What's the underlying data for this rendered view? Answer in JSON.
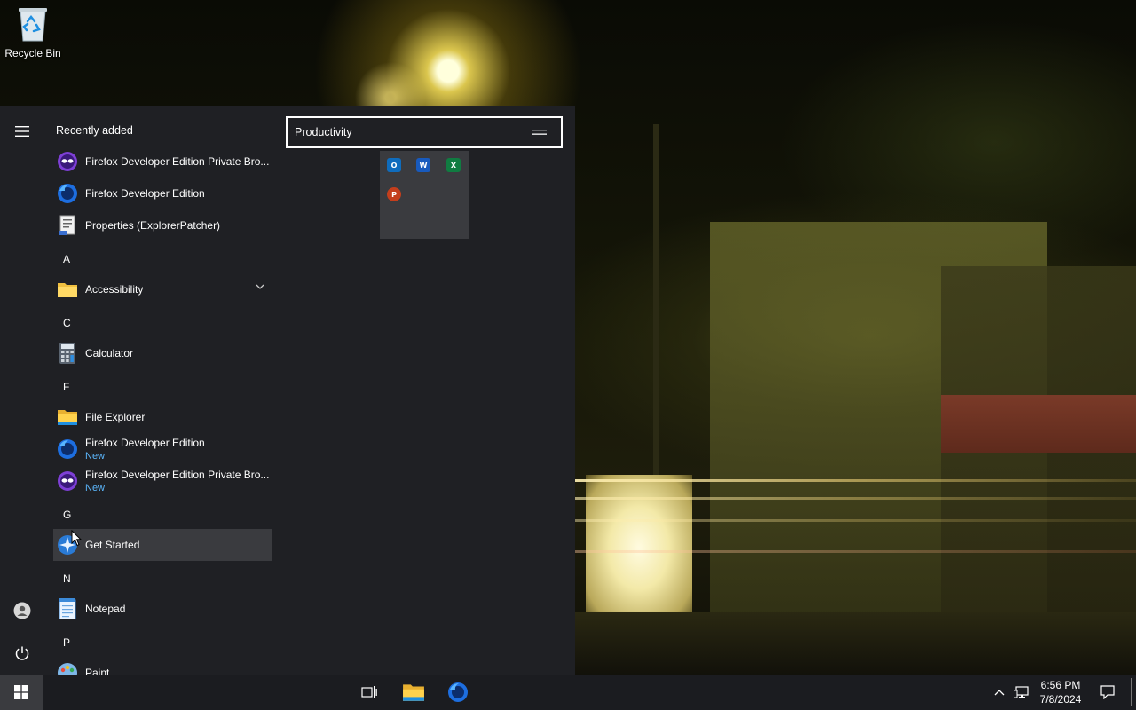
{
  "desktop": {
    "icons": [
      {
        "label": "Recycle Bin",
        "icon": "recycle-bin-icon"
      }
    ]
  },
  "start_menu": {
    "recently_added_title": "Recently added",
    "recently_added": [
      {
        "label": "Firefox Developer Edition Private Bro...",
        "icon": "firefox-private-icon"
      },
      {
        "label": "Firefox Developer Edition",
        "icon": "firefox-dev-icon"
      },
      {
        "label": "Properties (ExplorerPatcher)",
        "icon": "properties-icon"
      }
    ],
    "groups": [
      {
        "letter": "A",
        "apps": [
          {
            "label": "Accessibility",
            "icon": "folder-icon",
            "expandable": true
          }
        ]
      },
      {
        "letter": "C",
        "apps": [
          {
            "label": "Calculator",
            "icon": "calculator-icon"
          }
        ]
      },
      {
        "letter": "F",
        "apps": [
          {
            "label": "File Explorer",
            "icon": "file-explorer-icon"
          },
          {
            "label": "Firefox Developer Edition",
            "sub": "New",
            "icon": "firefox-dev-icon"
          },
          {
            "label": "Firefox Developer Edition Private Bro...",
            "sub": "New",
            "icon": "firefox-private-icon"
          }
        ]
      },
      {
        "letter": "G",
        "apps": [
          {
            "label": "Get Started",
            "icon": "get-started-icon",
            "hovered": true
          }
        ]
      },
      {
        "letter": "N",
        "apps": [
          {
            "label": "Notepad",
            "icon": "notepad-icon"
          }
        ]
      },
      {
        "letter": "P",
        "apps": [
          {
            "label": "Paint",
            "icon": "paint-icon"
          }
        ]
      }
    ],
    "tile_group": {
      "name": "Productivity",
      "folder_apps": [
        {
          "icon": "outlook-icon",
          "letter": "O",
          "color": "#0f6cbd"
        },
        {
          "icon": "word-icon",
          "letter": "W",
          "color": "#185abd"
        },
        {
          "icon": "excel-icon",
          "letter": "X",
          "color": "#107c41"
        },
        {
          "icon": "powerpoint-icon",
          "letter": "P",
          "color": "#c43e1c"
        }
      ]
    },
    "rail": [
      "hamburger-menu-icon",
      "user-account-icon",
      "power-icon"
    ]
  },
  "taskbar": {
    "buttons": [
      "start-button",
      "task-view-button",
      "file-explorer-taskbar-button",
      "firefox-taskbar-button"
    ],
    "tray": [
      "show-hidden-icons-chevron",
      "network-icon",
      "action-center-icon"
    ],
    "time": "6:56 PM",
    "date": "7/8/2024"
  },
  "colors": {
    "accent_blue": "#5cb8ff",
    "menu_bg": "#1f2024",
    "hover_bg": "#3a3b3f",
    "taskbar_bg": "#1b1c20"
  }
}
